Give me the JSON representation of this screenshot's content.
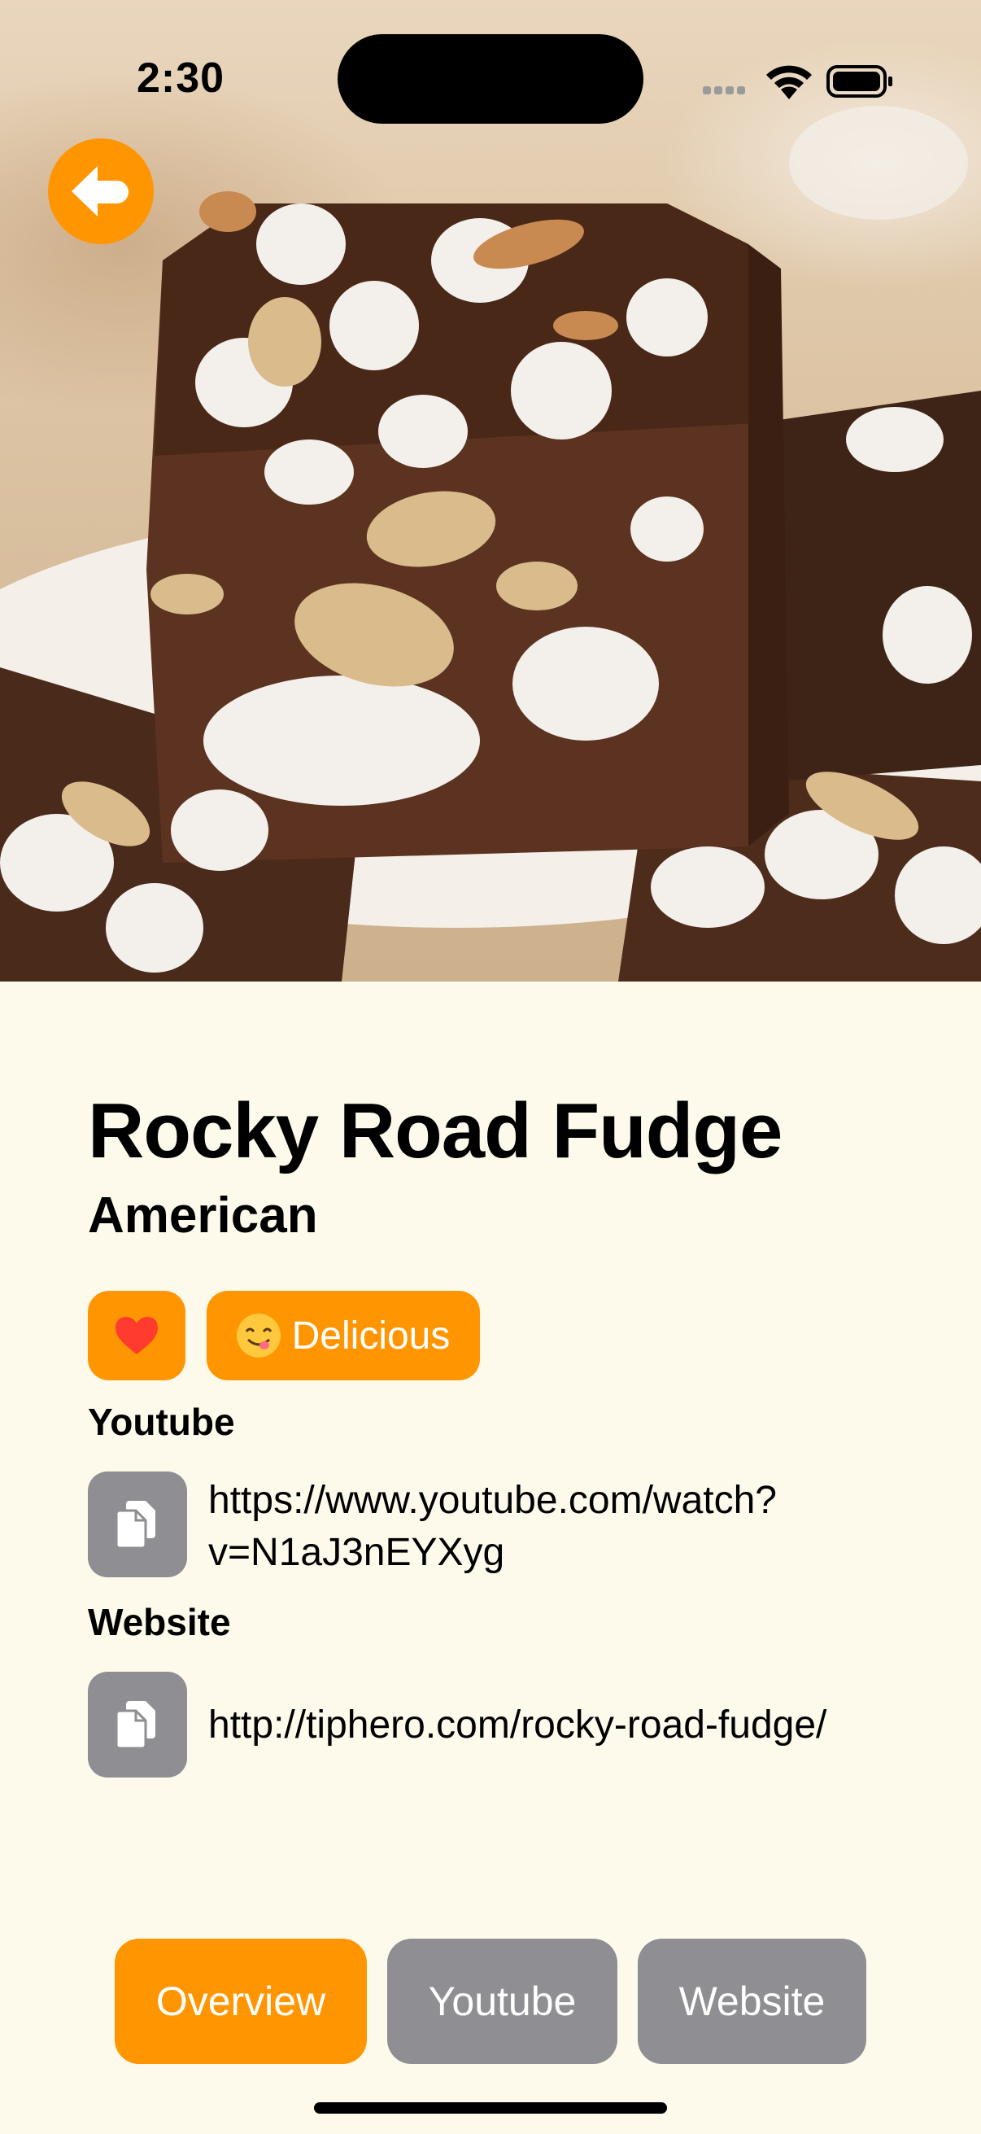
{
  "status_bar": {
    "time": "2:30"
  },
  "recipe": {
    "title": "Rocky Road Fudge",
    "cuisine": "American",
    "tag_label": "Delicious"
  },
  "links": [
    {
      "label": "Youtube",
      "url_line1": "https://www.youtube.com/watch?",
      "url_line2": "v=N1aJ3nEYXyg"
    },
    {
      "label": "Website",
      "url_line1": "http://tiphero.com/rocky-road-fudge/"
    }
  ],
  "tabs": [
    {
      "label": "Overview",
      "active": true
    },
    {
      "label": "Youtube",
      "active": false
    },
    {
      "label": "Website",
      "active": false
    }
  ],
  "colors": {
    "accent": "#FF9500",
    "inactive_tab": "#8E8E93",
    "background": "#FDFAEC",
    "heart": "#FF3B30"
  },
  "icons": {
    "back": "arrow-left-icon",
    "favorite": "heart-icon",
    "tag": "yum-face-emoji-icon",
    "copy": "copy-doc-icon"
  }
}
